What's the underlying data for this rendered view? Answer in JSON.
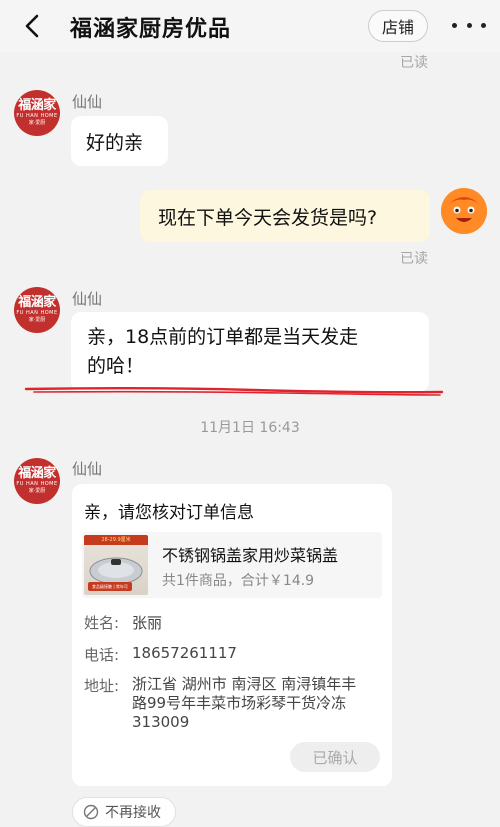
{
  "header": {
    "title": "福涵家厨房优品",
    "shop_label": "店铺"
  },
  "shop_avatar": {
    "main": "福涵家",
    "sub": "FU HAN HOME",
    "slogan": "家·爱厨"
  },
  "messages": {
    "read_label": "已读",
    "m1": {
      "sender": "仙仙",
      "text": "好的亲"
    },
    "m2": {
      "text": "现在下单今天会发货是吗?"
    },
    "m3": {
      "sender": "仙仙",
      "text_line1": "亲，18点前的订单都是当天发走",
      "text_line2": "的哈！"
    },
    "timestamp": "11月1日 16:43",
    "m4": {
      "sender": "仙仙"
    }
  },
  "order_card": {
    "title": "亲，请您核对订单信息",
    "product": {
      "name": "不锈钢锅盖家用炒菜锅盖",
      "summary": "共1件商品，合计￥14.9",
      "thumb_banner": "28-29.9厘米",
      "thumb_tag": "食品级接触 | 常年可"
    },
    "name_label": "姓名:",
    "name_value": "张丽",
    "phone_label": "电话:",
    "phone_value": "18657261117",
    "address_label": "地址:",
    "address_line1": "浙江省 湖州市 南浔区 南浔镇年丰",
    "address_line2": "路99号年丰菜市场彩琴干货冷冻",
    "address_line3": "313009",
    "confirm_label": "已确认"
  },
  "bottom": {
    "chip_label": "不再接收"
  },
  "colors": {
    "shop_red": "#c2302d",
    "my_bubble": "#fdf7df",
    "annotation_red": "#e0242d"
  }
}
